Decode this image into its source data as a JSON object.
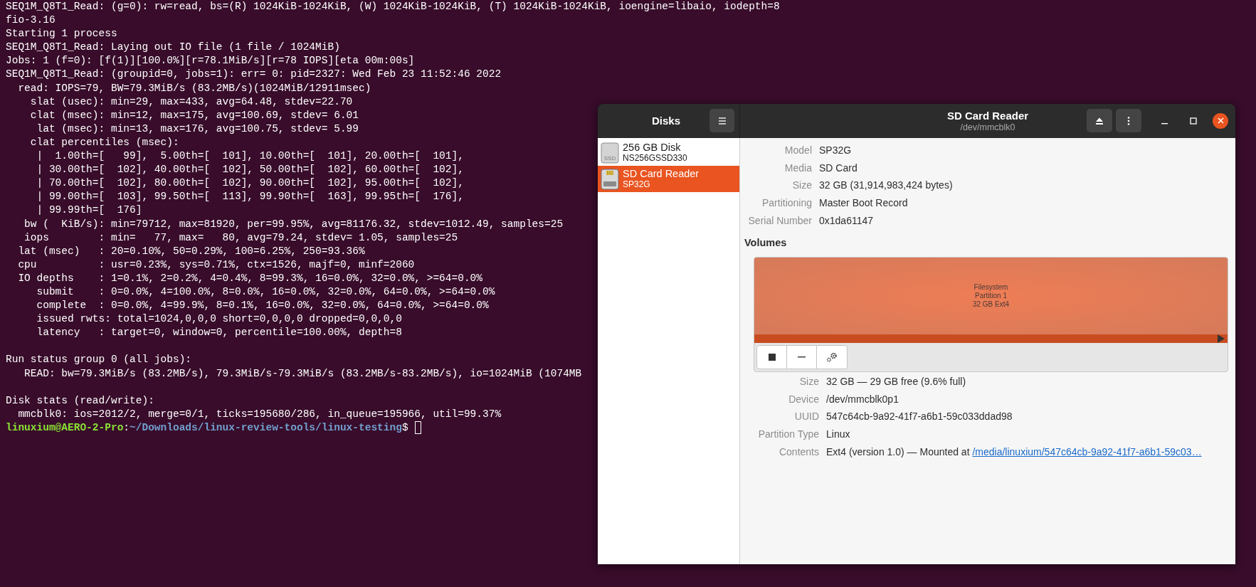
{
  "terminal": {
    "blocks": [
      [
        "SEQ1M_Q8T1_Read: (g=0): rw=read, bs=(R) 1024KiB-1024KiB, (W) 1024KiB-1024KiB, (T) 1024KiB-1024KiB, ioengine=libaio, iodepth=8",
        "fio-3.16",
        "Starting 1 process",
        "SEQ1M_Q8T1_Read: Laying out IO file (1 file / 1024MiB)",
        "Jobs: 1 (f=0): [f(1)][100.0%][r=78.1MiB/s][r=78 IOPS][eta 00m:00s]",
        "SEQ1M_Q8T1_Read: (groupid=0, jobs=1): err= 0: pid=2327: Wed Feb 23 11:52:46 2022",
        "  read: IOPS=79, BW=79.3MiB/s (83.2MB/s)(1024MiB/12911msec)",
        "    slat (usec): min=29, max=433, avg=64.48, stdev=22.70",
        "    clat (msec): min=12, max=175, avg=100.69, stdev= 6.01",
        "     lat (msec): min=13, max=176, avg=100.75, stdev= 5.99",
        "    clat percentiles (msec):",
        "     |  1.00th=[   99],  5.00th=[  101], 10.00th=[  101], 20.00th=[  101],",
        "     | 30.00th=[  102], 40.00th=[  102], 50.00th=[  102], 60.00th=[  102],",
        "     | 70.00th=[  102], 80.00th=[  102], 90.00th=[  102], 95.00th=[  102],",
        "     | 99.00th=[  103], 99.50th=[  113], 99.90th=[  163], 99.95th=[  176],",
        "     | 99.99th=[  176]",
        "   bw (  KiB/s): min=79712, max=81920, per=99.95%, avg=81176.32, stdev=1012.49, samples=25",
        "   iops        : min=   77, max=   80, avg=79.24, stdev= 1.05, samples=25",
        "  lat (msec)   : 20=0.10%, 50=0.29%, 100=6.25%, 250=93.36%",
        "  cpu          : usr=0.23%, sys=0.71%, ctx=1526, majf=0, minf=2060",
        "  IO depths    : 1=0.1%, 2=0.2%, 4=0.4%, 8=99.3%, 16=0.0%, 32=0.0%, >=64=0.0%",
        "     submit    : 0=0.0%, 4=100.0%, 8=0.0%, 16=0.0%, 32=0.0%, 64=0.0%, >=64=0.0%",
        "     complete  : 0=0.0%, 4=99.9%, 8=0.1%, 16=0.0%, 32=0.0%, 64=0.0%, >=64=0.0%",
        "     issued rwts: total=1024,0,0,0 short=0,0,0,0 dropped=0,0,0,0",
        "     latency   : target=0, window=0, percentile=100.00%, depth=8"
      ],
      [
        "Run status group 0 (all jobs):",
        "   READ: bw=79.3MiB/s (83.2MB/s), 79.3MiB/s-79.3MiB/s (83.2MB/s-83.2MB/s), io=1024MiB (1074MB"
      ],
      [
        "Disk stats (read/write):",
        "  mmcblk0: ios=2012/2, merge=0/1, ticks=195680/286, in_queue=195966, util=99.37%"
      ]
    ],
    "prompt": {
      "user_host": "linuxium@AERO-2-Pro",
      "separator": ":",
      "path": "~/Downloads/linux-review-tools/linux-testing",
      "symbol": "$"
    }
  },
  "disks": {
    "sidebar_title": "Disks",
    "title": "SD Card Reader",
    "subtitle": "/dev/mmcblk0",
    "drives": [
      {
        "kind": "ssd",
        "icon_text": "SSD",
        "name": "256 GB Disk",
        "model": "NS256GSSD330",
        "selected": false
      },
      {
        "kind": "sdcard",
        "name": "SD Card Reader",
        "model": "SP32G",
        "selected": true
      }
    ],
    "drive_info": [
      {
        "label": "Model",
        "value": "SP32G"
      },
      {
        "label": "Media",
        "value": "SD Card"
      },
      {
        "label": "Size",
        "value": "32 GB (31,914,983,424 bytes)"
      },
      {
        "label": "Partitioning",
        "value": "Master Boot Record"
      },
      {
        "label": "Serial Number",
        "value": "0x1da61147"
      }
    ],
    "volumes_heading": "Volumes",
    "partition": {
      "lines": [
        "Filesystem",
        "Partition 1",
        "32 GB Ext4"
      ],
      "selected": true
    },
    "partition_info": [
      {
        "label": "Size",
        "value": "32 GB — 29 GB free (9.6% full)"
      },
      {
        "label": "Device",
        "value": "/dev/mmcblk0p1"
      },
      {
        "label": "UUID",
        "value": "547c64cb-9a92-41f7-a6b1-59c033ddad98"
      },
      {
        "label": "Partition Type",
        "value": "Linux"
      },
      {
        "label": "Contents",
        "value": "Ext4 (version 1.0) — Mounted at ",
        "link": "/media/linuxium/547c64cb-9a92-41f7-a6b1-59c03…"
      }
    ]
  }
}
